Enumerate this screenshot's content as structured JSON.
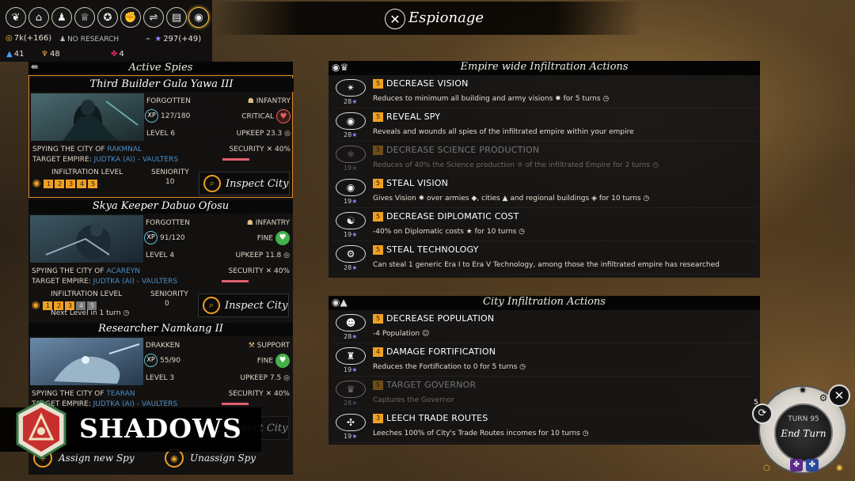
{
  "title": "Espionage",
  "topbar": {
    "categories": [
      "laurel-icon",
      "temple-icon",
      "population-icon",
      "trophy-icon",
      "medal-icon",
      "fist-icon",
      "handshake-icon",
      "cards-icon",
      "eye-icon"
    ],
    "gold": "7k(+166)",
    "research": "NO RESEARCH",
    "influence": "297(+49)",
    "water": "41",
    "food": "48",
    "faith": "4"
  },
  "spies_panel": {
    "header": "Active Spies",
    "spies": [
      {
        "name": "Third Builder Gula Yawa III",
        "race": "FORGOTTEN",
        "role": "INFANTRY",
        "xp": "127/180",
        "health": "CRITICAL",
        "level": "LEVEL 6",
        "upkeep": "UPKEEP 23.3",
        "spying_label": "SPYING THE CITY OF",
        "city": "RAKMNAL",
        "security_label": "SECURITY",
        "security": "40%",
        "target_label": "TARGET EMPIRE:",
        "target": "JUDTKA (AI) - VAULTERS",
        "infiltration_label": "INFILTRATION LEVEL",
        "seniority_label": "SENIORITY",
        "seniority": "10",
        "levels": [
          "1",
          "2",
          "3",
          "4",
          "5"
        ],
        "levels_on": 5,
        "inspect": "Inspect City"
      },
      {
        "name": "Skya Keeper Dabuo Ofosu",
        "race": "FORGOTTEN",
        "role": "INFANTRY",
        "xp": "91/120",
        "health": "FINE",
        "level": "LEVEL 4",
        "upkeep": "UPKEEP 11.8",
        "spying_label": "SPYING THE CITY OF",
        "city": "ACAREYN",
        "security_label": "SECURITY",
        "security": "40%",
        "target_label": "TARGET EMPIRE:",
        "target": "JUDTKA (AI) - VAULTERS",
        "infiltration_label": "INFILTRATION LEVEL",
        "seniority_label": "SENIORITY",
        "seniority": "0",
        "levels": [
          "1",
          "2",
          "3",
          "4",
          "5"
        ],
        "levels_on": 3,
        "next_level": "Next Level in 1 turn",
        "inspect": "Inspect City"
      },
      {
        "name": "Researcher Namkang II",
        "race": "DRAKKEN",
        "role": "SUPPORT",
        "xp": "55/90",
        "health": "FINE",
        "level": "LEVEL 3",
        "upkeep": "UPKEEP 7.5",
        "spying_label": "SPYING THE CITY OF",
        "city": "TEARAN",
        "security_label": "SECURITY",
        "security": "40%",
        "target_label": "TARGET EMPIRE:",
        "target": "JUDTKA (AI) - VAULTERS",
        "inspect": "Inspect City"
      }
    ],
    "assign": "Assign new Spy",
    "unassign": "Unassign Spy"
  },
  "empire_actions": {
    "header": "Empire wide Infiltration Actions",
    "items": [
      {
        "level": "5",
        "name": "DECREASE VISION",
        "desc": "Reduces  to minimum all building and army visions ✸  for 5 turns ◷",
        "cost": "28",
        "enabled": true
      },
      {
        "level": "5",
        "name": "REVEAL SPY",
        "desc": "Reveals and wounds all spies of the infiltrated empire within your empire",
        "cost": "28",
        "enabled": true
      },
      {
        "level": "5",
        "name": "DECREASE SCIENCE PRODUCTION",
        "desc": "Reduces of 40% the Science production ⚛ of the infiltrated Empire  for 2 turns ◷",
        "cost": "19",
        "enabled": false
      },
      {
        "level": "5",
        "name": "STEAL VISION",
        "desc": "Gives Vision ✸ over armies ◆, cities ▲ and regional buildings ◈  for 10 turns ◷",
        "cost": "19",
        "enabled": true
      },
      {
        "level": "5",
        "name": "DECREASE DIPLOMATIC COST",
        "desc": "-40% on Diplomatic costs ★  for 10 turns ◷",
        "cost": "19",
        "enabled": true
      },
      {
        "level": "5",
        "name": "STEAL TECHNOLOGY",
        "desc": "Can steal 1 generic Era I to Era V Technology, among  those  the infiltrated empire has researched",
        "cost": "28",
        "enabled": true
      }
    ]
  },
  "city_actions": {
    "header": "City Infiltration Actions",
    "items": [
      {
        "level": "5",
        "name": "DECREASE POPULATION",
        "desc": "-4 Population ☺",
        "cost": "28",
        "enabled": true
      },
      {
        "level": "4",
        "name": "DAMAGE FORTIFICATION",
        "desc": "Reduces  the Fortification to 0 for 5 turns ◷",
        "cost": "19",
        "enabled": true
      },
      {
        "level": "5",
        "name": "TARGET GOVERNOR",
        "desc": "Captures  the Governor",
        "cost": "28",
        "enabled": false
      },
      {
        "level": "3",
        "name": "LEECH TRADE ROUTES",
        "desc": "Leeches 100% of City's Trade Routes incomes  for 10 turns ◷",
        "cost": "19",
        "enabled": true
      }
    ]
  },
  "banner": "SHADOWS",
  "end_turn": {
    "turn": "TURN 95",
    "label": "End Turn",
    "count": "5"
  }
}
